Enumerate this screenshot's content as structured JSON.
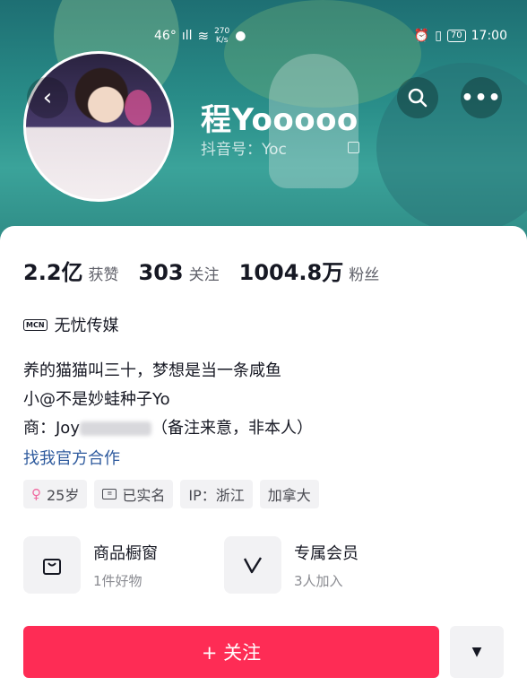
{
  "status_bar": {
    "network": "46°",
    "signal": "ıll",
    "speed_value": "270",
    "speed_unit": "K/s",
    "time": "17:00",
    "battery": "70"
  },
  "profile": {
    "name": "程Yooooo",
    "douyin_id_label": "抖音号：Yoc"
  },
  "stats": [
    {
      "value": "2.2亿",
      "label": "获赞"
    },
    {
      "value": "303",
      "label": "关注"
    },
    {
      "value": "1004.8万",
      "label": "粉丝"
    }
  ],
  "mcn": {
    "badge": "MCN",
    "name": "无忧传媒"
  },
  "bio": {
    "line1": "养的猫猫叫三十，梦想是当一条咸鱼",
    "line2": "小@不是妙蛙种子Yo",
    "line3_prefix": "商：Joy",
    "line3_suffix": "（备注来意，非本人）"
  },
  "cooperation_link": "找我官方合作",
  "tags": {
    "age": "25岁",
    "verified": "已实名",
    "ip": "IP：浙江",
    "location": "加拿大"
  },
  "features": [
    {
      "title": "商品橱窗",
      "subtitle": "1件好物"
    },
    {
      "title": "专属会员",
      "subtitle": "3人加入"
    }
  ],
  "actions": {
    "follow": "+ 关注"
  },
  "colors": {
    "follow_button": "#fe2c55",
    "link": "#2f5b9e",
    "header": "#2a8f8a"
  }
}
